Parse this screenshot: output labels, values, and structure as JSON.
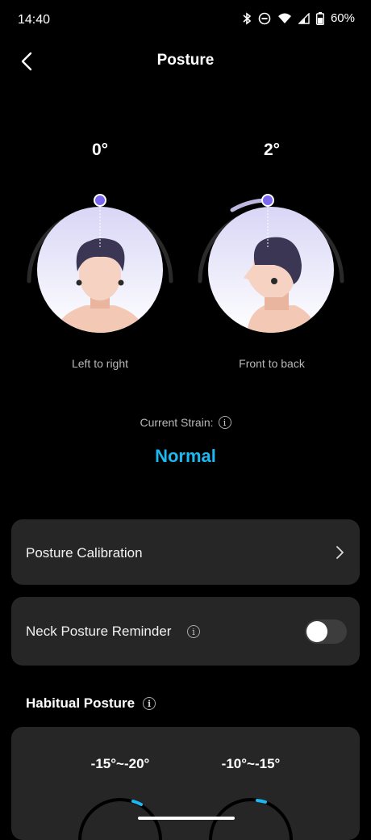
{
  "status_bar": {
    "time": "14:40",
    "battery": "60%"
  },
  "header": {
    "title": "Posture"
  },
  "gauges": [
    {
      "angle": "0°",
      "label": "Left to right"
    },
    {
      "angle": "2°",
      "label": "Front to back"
    }
  ],
  "strain": {
    "label": "Current Strain:",
    "value": "Normal",
    "value_color": "#1cb8f0"
  },
  "settings": {
    "calibration_label": "Posture Calibration",
    "reminder_label": "Neck Posture Reminder",
    "reminder_on": false
  },
  "habitual": {
    "title": "Habitual Posture",
    "ranges": [
      "-15°~-20°",
      "-10°~-15°"
    ]
  },
  "icons": [
    "bluetooth-icon",
    "dnd-icon",
    "wifi-icon",
    "signal-icon",
    "battery-icon",
    "back-arrow-icon",
    "info-icon",
    "chevron-right-icon"
  ],
  "colors": {
    "accent": "#7b68ee",
    "highlight": "#1cb8f0",
    "card": "#262626"
  }
}
